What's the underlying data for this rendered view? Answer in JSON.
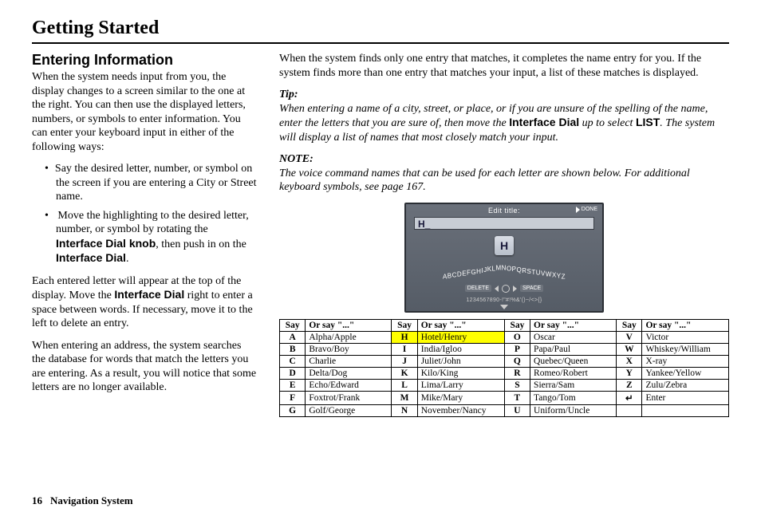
{
  "chapter": "Getting Started",
  "section_heading": "Entering Information",
  "left": {
    "intro": "When the system needs input from you, the display changes to a screen similar to the one at the right. You can then use the displayed letters, numbers, or symbols to enter information. You can enter your keyboard input in either of the following ways:",
    "bullets": [
      {
        "pre": "Say the desired letter, number, or symbol on the screen if you are entering a City or Street name."
      },
      {
        "pre": "Move the highlighting to the desired letter, number, or symbol by rotating the ",
        "b1": "Interface Dial knob",
        "mid": ", then push in on the ",
        "b2": "Interface Dial",
        "tail": "."
      }
    ],
    "p2_a": "Each entered letter will appear at the top of the display. Move the ",
    "p2_b": "Interface Dial",
    "p2_c": " right to enter a space between words. If necessary, move it to the left to delete an entry.",
    "p3": "When entering an address, the system searches the database for words that match the letters you are entering. As a result, you will notice that some letters are no longer available."
  },
  "right": {
    "top": "When the system finds only one entry that matches, it completes the name entry for you. If the system finds more than one entry that matches your input, a list of these matches is displayed.",
    "tip_head": "Tip:",
    "tip_a": "When entering a name of a city, street, or place, or if you are unsure of the spelling of the name, enter the letters that you are sure of, then move the ",
    "tip_b": "Interface Dial",
    "tip_c": " up to select ",
    "tip_d": "LIST",
    "tip_e": ". The system will display a list of names that most closely match your input.",
    "note_head": "NOTE:",
    "note": "The voice command names that can be used for each letter are shown below. For additional keyboard symbols, see page 167."
  },
  "screen": {
    "title": "Edit title:",
    "done": "DONE",
    "value": "H_",
    "key": "H",
    "alphabet": "ABCDEFGHIJKLMNOPQRSTUVWXYZ",
    "delete": "DELETE",
    "space": "SPACE",
    "digits": "1234567890-!\"#!%&'()~/<>{}"
  },
  "table": {
    "hdr_say": "Say",
    "hdr_or": "Or say \"...\"",
    "cols": [
      [
        [
          "A",
          "Alpha/Apple"
        ],
        [
          "B",
          "Bravo/Boy"
        ],
        [
          "C",
          "Charlie"
        ],
        [
          "D",
          "Delta/Dog"
        ],
        [
          "E",
          "Echo/Edward"
        ],
        [
          "F",
          "Foxtrot/Frank"
        ],
        [
          "G",
          "Golf/George"
        ]
      ],
      [
        [
          "H",
          "Hotel/Henry"
        ],
        [
          "I",
          "India/Igloo"
        ],
        [
          "J",
          "Juliet/John"
        ],
        [
          "K",
          "Kilo/King"
        ],
        [
          "L",
          "Lima/Larry"
        ],
        [
          "M",
          "Mike/Mary"
        ],
        [
          "N",
          "November/Nancy"
        ]
      ],
      [
        [
          "O",
          "Oscar"
        ],
        [
          "P",
          "Papa/Paul"
        ],
        [
          "Q",
          "Quebec/Queen"
        ],
        [
          "R",
          "Romeo/Robert"
        ],
        [
          "S",
          "Sierra/Sam"
        ],
        [
          "T",
          "Tango/Tom"
        ],
        [
          "U",
          "Uniform/Uncle"
        ]
      ],
      [
        [
          "V",
          "Victor"
        ],
        [
          "W",
          "Whiskey/William"
        ],
        [
          "X",
          "X-ray"
        ],
        [
          "Y",
          "Yankee/Yellow"
        ],
        [
          "Z",
          "Zulu/Zebra"
        ],
        [
          "↵",
          "Enter"
        ],
        [
          "",
          ""
        ]
      ]
    ],
    "highlight": {
      "col": 1,
      "row": 0
    }
  },
  "footer": {
    "page": "16",
    "pub": "Navigation System"
  }
}
